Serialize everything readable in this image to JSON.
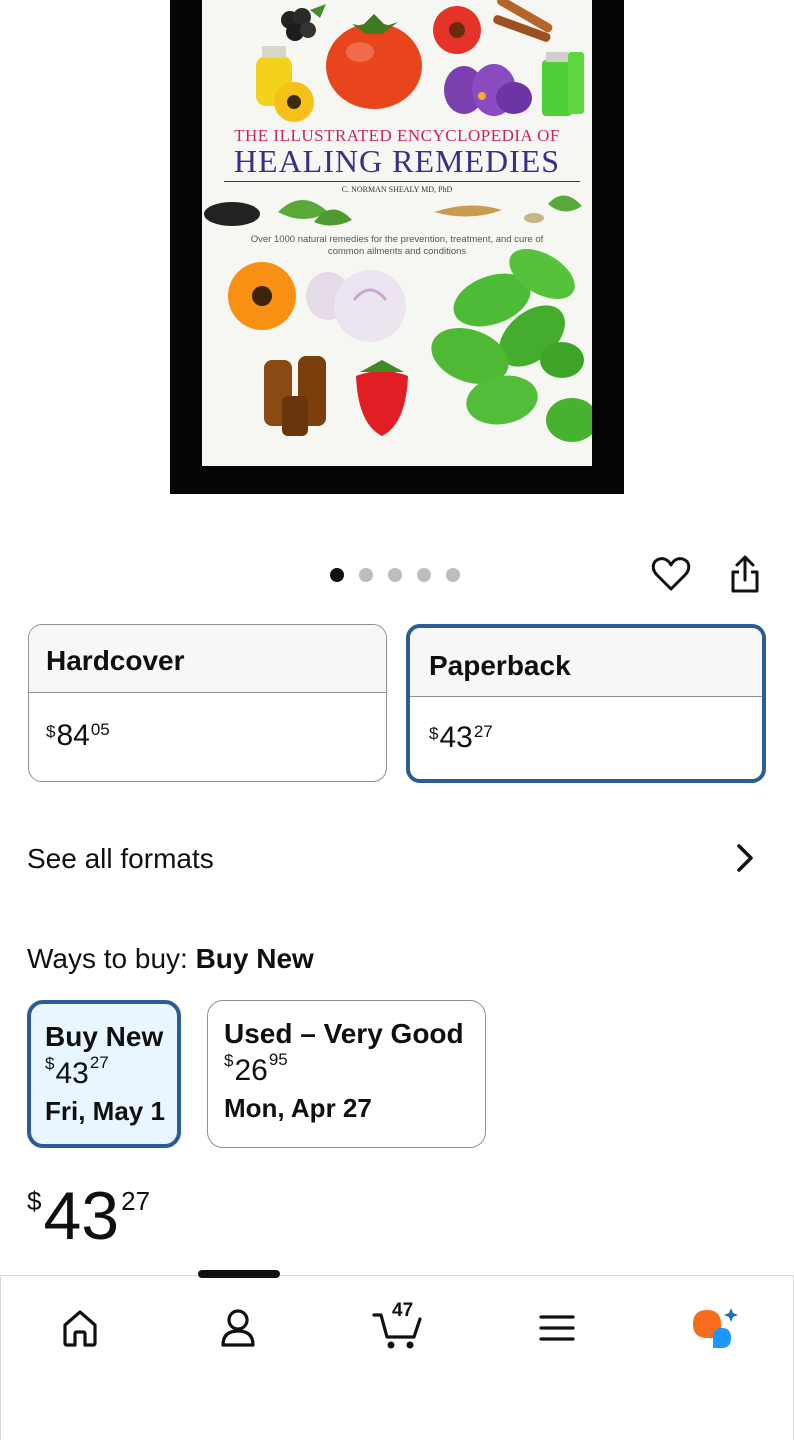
{
  "product": {
    "cover": {
      "title_line_1": "THE ILLUSTRATED ENCYCLOPEDIA OF",
      "title_line_2": "HEALING REMEDIES",
      "author": "C. NORMAN SHEALY MD, PhD",
      "tagline": "Over 1000 natural remedies for the prevention, treatment, and cure of common ailments and conditions"
    },
    "carousel": {
      "image_count": 5,
      "active_index": 0
    }
  },
  "actions": {
    "wishlist_icon": "heart-icon",
    "share_icon": "share-icon"
  },
  "formats": [
    {
      "name": "Hardcover",
      "price_symbol": "$",
      "price_whole": "84",
      "price_fraction": "05",
      "selected": false
    },
    {
      "name": "Paperback",
      "price_symbol": "$",
      "price_whole": "43",
      "price_fraction": "27",
      "selected": true
    }
  ],
  "see_all_formats": {
    "label": "See all formats",
    "icon": "chevron-right-icon"
  },
  "ways_to_buy": {
    "label": "Ways to buy:",
    "selected_label": "Buy New",
    "options": [
      {
        "title": "Buy New",
        "price_symbol": "$",
        "price_whole": "43",
        "price_fraction": "27",
        "delivery": "Fri, May 1",
        "selected": true
      },
      {
        "title": "Used – Very Good",
        "price_symbol": "$",
        "price_whole": "26",
        "price_fraction": "95",
        "delivery": "Mon, Apr 27",
        "selected": false
      }
    ]
  },
  "price": {
    "symbol": "$",
    "whole": "43",
    "fraction": "27"
  },
  "bottom_nav": {
    "items": [
      "home-icon",
      "account-icon",
      "cart-icon",
      "menu-icon",
      "rufus-icon"
    ],
    "cart_count": "47",
    "active_index": 1
  },
  "colors": {
    "selected_border": "#2b5c97",
    "selected_fill": "#eaf6fd",
    "rufus_orange": "#f76b1c",
    "rufus_blue": "#1a98ff"
  }
}
